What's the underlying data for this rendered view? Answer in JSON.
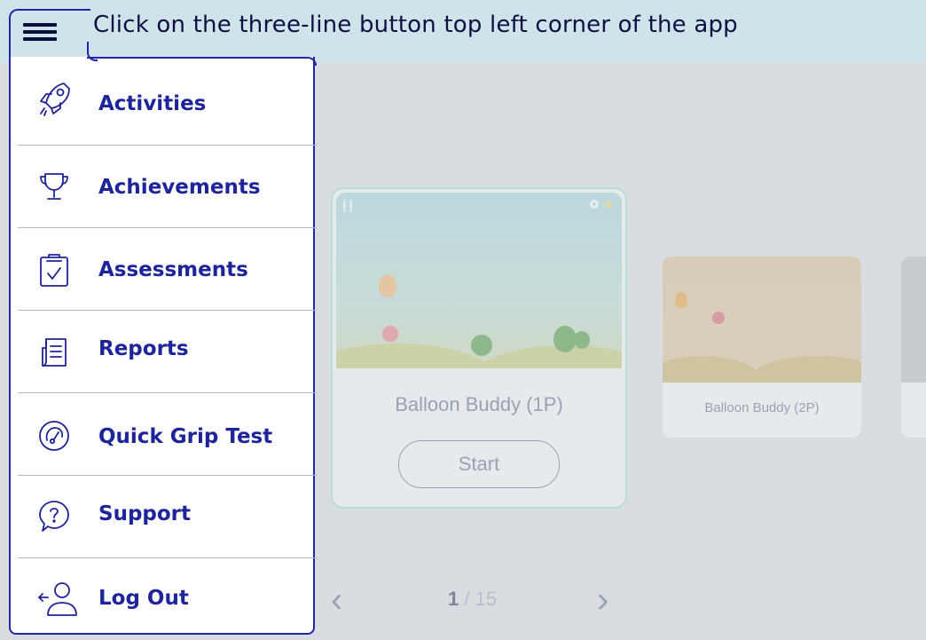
{
  "banner": {
    "instruction": "Click on the three-line button top left corner of the app"
  },
  "menu": {
    "items": [
      {
        "label": "Activities",
        "icon": "rocket-icon"
      },
      {
        "label": "Achievements",
        "icon": "trophy-icon"
      },
      {
        "label": "Assessments",
        "icon": "clipboard-check-icon"
      },
      {
        "label": "Reports",
        "icon": "report-document-icon"
      },
      {
        "label": "Quick Grip Test",
        "icon": "grip-gauge-icon"
      },
      {
        "label": "Support",
        "icon": "help-bubble-icon"
      },
      {
        "label": "Log Out",
        "icon": "logout-user-icon"
      }
    ]
  },
  "activities": {
    "cards": [
      {
        "title": "Balloon Buddy (1P)",
        "action": "Start"
      },
      {
        "title": "Balloon Buddy (2P)"
      }
    ]
  },
  "pager": {
    "current": "1",
    "separator": "/",
    "total": "15"
  },
  "colors": {
    "accent": "#2326a8",
    "menu_text": "#1e2499",
    "banner_bg": "#cfe4ea",
    "overlay_bg": "#d9dde1"
  }
}
